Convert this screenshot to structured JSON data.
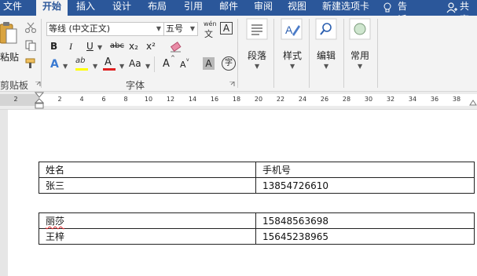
{
  "tabs": [
    {
      "label": "文件",
      "active": false
    },
    {
      "label": "开始",
      "active": true
    },
    {
      "label": "插入",
      "active": false
    },
    {
      "label": "设计",
      "active": false
    },
    {
      "label": "布局",
      "active": false
    },
    {
      "label": "引用",
      "active": false
    },
    {
      "label": "邮件",
      "active": false
    },
    {
      "label": "审阅",
      "active": false
    },
    {
      "label": "视图",
      "active": false
    },
    {
      "label": "新建选项卡",
      "active": false
    }
  ],
  "tell_me": "告诉我",
  "share": "共享",
  "clipboard": {
    "paste_label": "粘贴",
    "group_label": "剪贴板"
  },
  "font": {
    "group_label": "字体",
    "font_name": "等线 (中文正文)",
    "font_size": "五号",
    "phonetic_top": "wén",
    "phonetic_bottom": "文",
    "border_char": "A",
    "bold": "B",
    "italic": "I",
    "underline": "U",
    "strike": "abc",
    "subscript": "x₂",
    "superscript": "x²",
    "text_effect": "A",
    "highlight": "ab",
    "font_color": "A",
    "change_case": "Aa",
    "grow": "A",
    "shrink": "A",
    "shading": "A",
    "enclose": "字"
  },
  "groups": {
    "paragraph": "段落",
    "styles": "样式",
    "editing": "编辑",
    "common": "常用"
  },
  "ruler": {
    "ticks": [
      "2",
      "2",
      "4",
      "6",
      "8",
      "10",
      "12",
      "14",
      "16",
      "18",
      "20",
      "22",
      "24",
      "26",
      "28",
      "30",
      "32",
      "34",
      "36",
      "38"
    ]
  },
  "table1": {
    "rows": [
      [
        "姓名",
        "手机号"
      ],
      [
        "张三",
        "13854726610"
      ]
    ]
  },
  "table2": {
    "rows": [
      [
        "丽莎",
        "15848563698"
      ],
      [
        "王梓",
        "15645238965"
      ]
    ]
  },
  "colors": {
    "accent": "#2b579a",
    "highlight_bar": "#ffff00",
    "font_color_bar": "#e02020"
  }
}
